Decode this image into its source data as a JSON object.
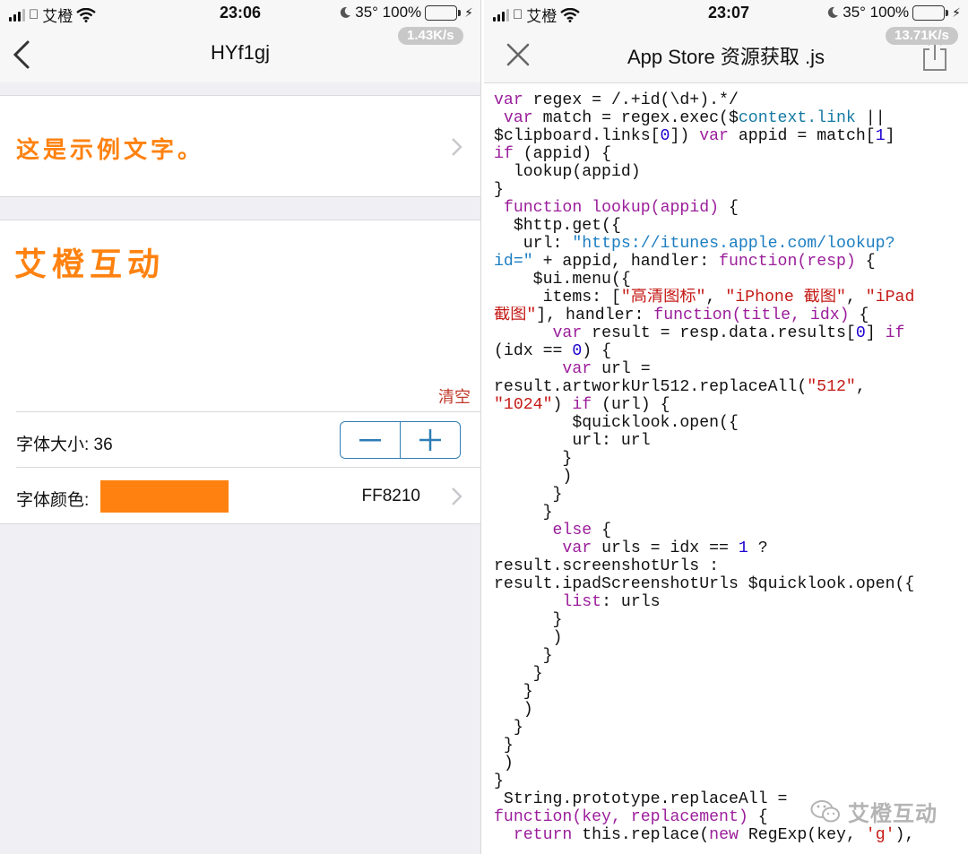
{
  "left": {
    "status": {
      "carrier": "艾橙",
      "time": "23:06",
      "battery": "35° 100%",
      "speed": "1.43K/s"
    },
    "nav": {
      "title": "HYf1gj"
    },
    "sample_text": "这是示例文字。",
    "editor_text": "艾橙互动",
    "clear_label": "清空",
    "font_size_label": "字体大小: 36",
    "font_color_label": "字体颜色:",
    "font_color_hex": "FF8210",
    "accent_color": "#ff8210"
  },
  "right": {
    "status": {
      "carrier": "艾橙",
      "time": "23:07",
      "battery": "35° 100%",
      "speed": "13.71K/s"
    },
    "nav": {
      "title": "App Store 资源获取 .js"
    },
    "code_lines": [
      [
        [
          "",
          "var"
        ],
        [
          "",
          " regex = /.+id(\\d+).*/"
        ]
      ],
      [
        [
          "",
          " "
        ],
        [
          "k",
          "var"
        ],
        [
          "",
          " match = regex.exec($"
        ],
        [
          "v",
          "context.link"
        ],
        [
          "",
          " ||"
        ]
      ],
      [
        [
          "",
          "$clipboard.links["
        ],
        [
          "n",
          "0"
        ],
        [
          "",
          "]) "
        ],
        [
          "k",
          "var"
        ],
        [
          "",
          " appid = match["
        ],
        [
          "n",
          "1"
        ],
        [
          "",
          "]"
        ]
      ],
      [
        [
          "k",
          "if"
        ],
        [
          "",
          " (appid) {"
        ]
      ],
      [
        [
          "",
          "  lookup(appid)"
        ]
      ],
      [
        [
          "",
          "}"
        ]
      ],
      [
        [
          "",
          " "
        ],
        [
          "k",
          "function"
        ],
        [
          "",
          " "
        ],
        [
          "k",
          "lookup(appid)"
        ],
        [
          "",
          " {"
        ]
      ],
      [
        [
          "",
          "  $http.get({"
        ]
      ],
      [
        [
          "",
          "   url: "
        ],
        [
          "u",
          "\"https://itunes.apple.com/lookup?"
        ]
      ],
      [
        [
          "u",
          "id=\""
        ],
        [
          "",
          " + appid, handler: "
        ],
        [
          "k",
          "function(resp)"
        ],
        [
          "",
          " {"
        ]
      ],
      [
        [
          "",
          "    $ui.menu({"
        ]
      ],
      [
        [
          "",
          "     items: ["
        ],
        [
          "s",
          "\"高清图标\""
        ],
        [
          "",
          ", "
        ],
        [
          "s",
          "\"iPhone 截图\""
        ],
        [
          "",
          ", "
        ],
        [
          "s",
          "\"iPad"
        ]
      ],
      [
        [
          "s",
          "截图\""
        ],
        [
          "",
          "], handler: "
        ],
        [
          "k",
          "function(title, idx)"
        ],
        [
          "",
          " {"
        ]
      ],
      [
        [
          "",
          "      "
        ],
        [
          "k",
          "var"
        ],
        [
          "",
          " result = resp.data.results["
        ],
        [
          "n",
          "0"
        ],
        [
          "",
          "] "
        ],
        [
          "k",
          "if"
        ]
      ],
      [
        [
          "",
          "(idx == "
        ],
        [
          "n",
          "0"
        ],
        [
          "",
          ") {"
        ]
      ],
      [
        [
          "",
          "       "
        ],
        [
          "k",
          "var"
        ],
        [
          "",
          " url ="
        ]
      ],
      [
        [
          "",
          "result.artworkUrl512.replaceAll("
        ],
        [
          "s",
          "\"512\""
        ],
        [
          "",
          ","
        ]
      ],
      [
        [
          "s",
          "\"1024\""
        ],
        [
          "",
          ") "
        ],
        [
          "k",
          "if"
        ],
        [
          "",
          " (url) {"
        ]
      ],
      [
        [
          "",
          "        $quicklook.open({"
        ]
      ],
      [
        [
          "",
          "        url: url"
        ]
      ],
      [
        [
          "",
          "       }"
        ]
      ],
      [
        [
          "",
          "       )"
        ]
      ],
      [
        [
          "",
          "      }"
        ]
      ],
      [
        [
          "",
          "     }"
        ]
      ],
      [
        [
          "",
          "      "
        ],
        [
          "k",
          "else"
        ],
        [
          "",
          " {"
        ]
      ],
      [
        [
          "",
          "       "
        ],
        [
          "k",
          "var"
        ],
        [
          "",
          " urls = idx == "
        ],
        [
          "n",
          "1"
        ],
        [
          "",
          " ?"
        ]
      ],
      [
        [
          "",
          "result.screenshotUrls :"
        ]
      ],
      [
        [
          "",
          "result.ipadScreenshotUrls $quicklook.open({"
        ]
      ],
      [
        [
          "",
          "       "
        ],
        [
          "k",
          "list"
        ],
        [
          "",
          ": urls"
        ]
      ],
      [
        [
          "",
          "      }"
        ]
      ],
      [
        [
          "",
          "      )"
        ]
      ],
      [
        [
          "",
          "     }"
        ]
      ],
      [
        [
          "",
          "    }"
        ]
      ],
      [
        [
          "",
          "   }"
        ]
      ],
      [
        [
          "",
          "   )"
        ]
      ],
      [
        [
          "",
          "  }"
        ]
      ],
      [
        [
          "",
          " }"
        ]
      ],
      [
        [
          "",
          " )"
        ]
      ],
      [
        [
          "",
          "}"
        ]
      ],
      [
        [
          "",
          " String.prototype.replaceAll ="
        ]
      ],
      [
        [
          "k",
          "function(key, replacement)"
        ],
        [
          "",
          " {"
        ]
      ],
      [
        [
          "",
          "  "
        ],
        [
          "k",
          "return"
        ],
        [
          "",
          " this.replace("
        ],
        [
          "k",
          "new"
        ],
        [
          "",
          " RegExp(key, "
        ],
        [
          "s",
          "'g'"
        ],
        [
          "",
          "),"
        ]
      ]
    ],
    "watermark": "艾橙互动"
  }
}
